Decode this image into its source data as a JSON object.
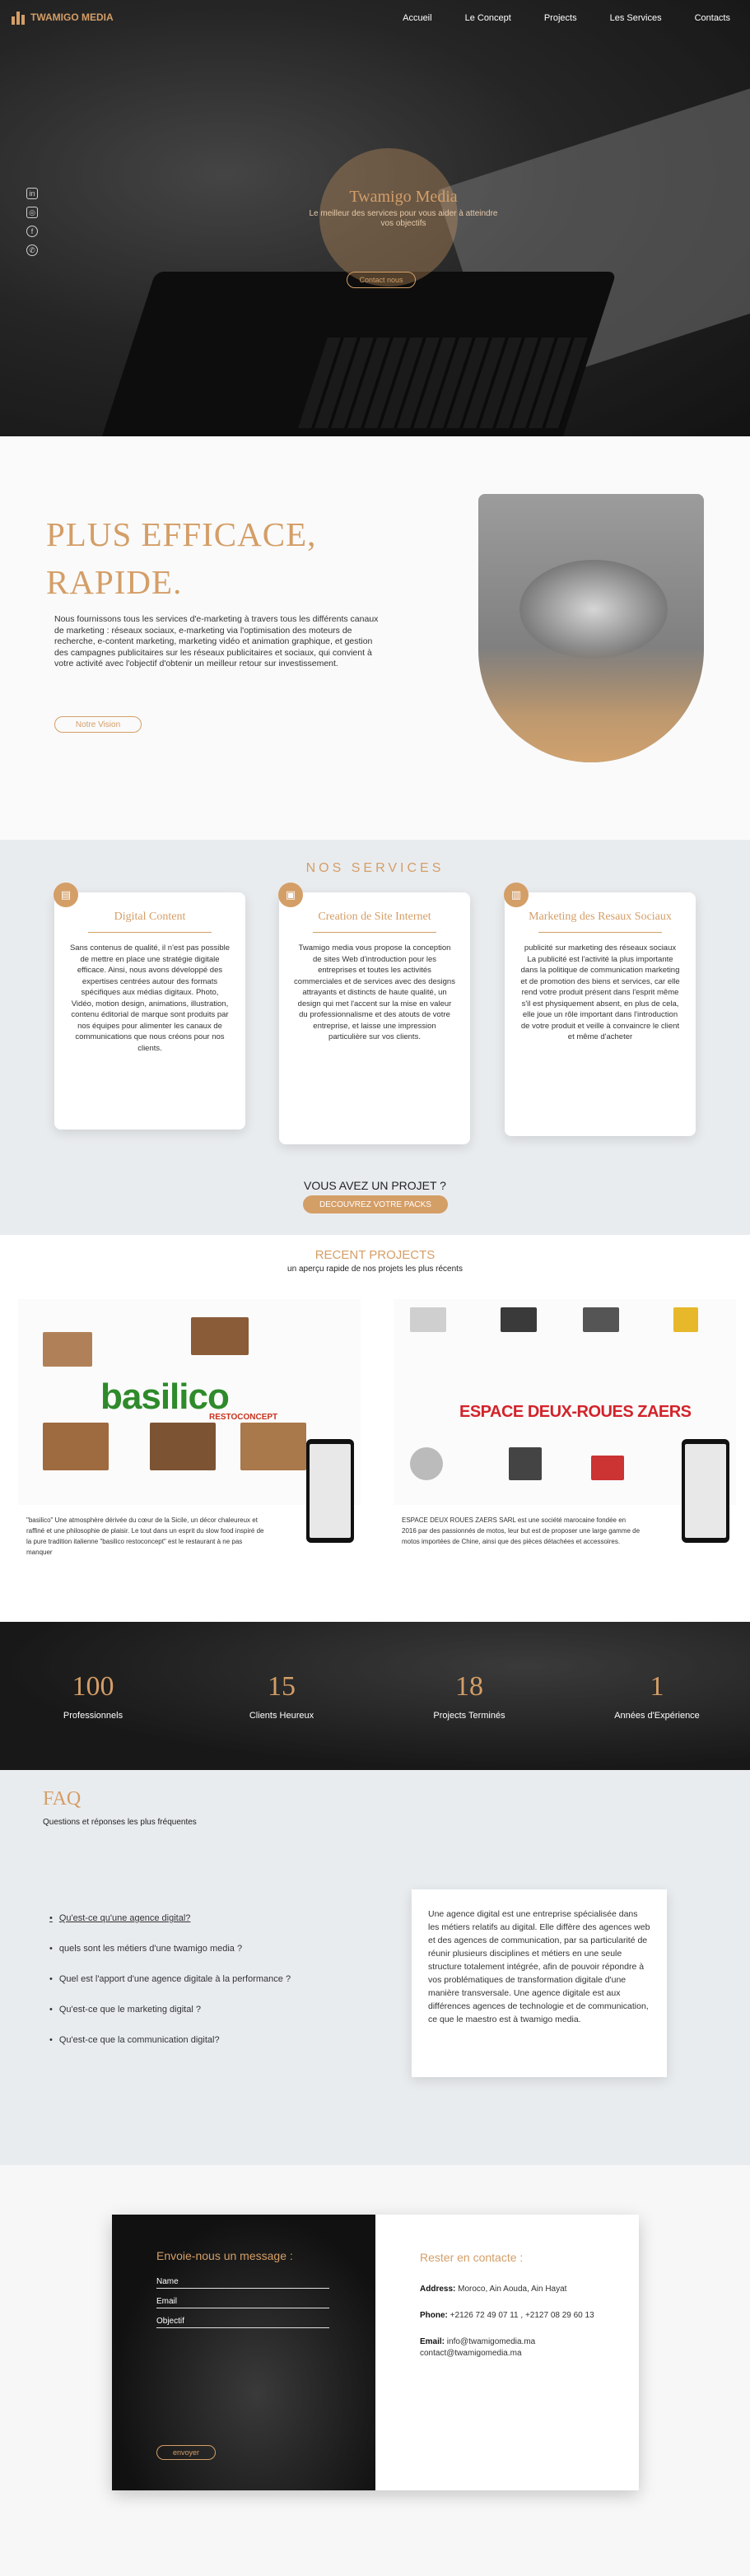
{
  "brand": {
    "name": "TWAMIGO MEDIA",
    "accent": "#d49e67"
  },
  "nav": [
    "Accueil",
    "Le Concept",
    "Projects",
    "Les Services",
    "Contacts"
  ],
  "social_icons": [
    "linkedin-icon",
    "instagram-icon",
    "facebook-icon",
    "whatsapp-icon"
  ],
  "hero": {
    "title": "Twamigo Media",
    "subtitle": "Le meilleur des services pour vous aider à atteindre vos objectifs",
    "button": "Contact nous"
  },
  "about": {
    "heading": "PLUS EFFICACE, RAPIDE.",
    "text": "Nous fournissons tous les services d'e-marketing à travers tous les différents canaux de marketing : réseaux sociaux, e-marketing via l'optimisation des moteurs de recherche, e-content marketing, marketing vidéo et animation graphique, et gestion des campagnes publicitaires sur les réseaux publicitaires et sociaux, qui convient à votre activité avec l'objectif d'obtenir un meilleur retour sur investissement.",
    "button": "Notre Vision"
  },
  "services": {
    "title": "NOS SERVICES",
    "cards": [
      {
        "title": "Digital Content",
        "icon": "content-icon",
        "text": "Sans contenus de qualité, il n'est pas possible de mettre en place une stratégie digitale efficace. Ainsi, nous avons développé des expertises centrées autour des formats spécifiques aux médias digitaux. Photo, Vidéo, motion design, animations, illustration, contenu éditorial de marque sont produits par nos équipes pour alimenter les canaux de communications que nous créons pour nos clients."
      },
      {
        "title": "Creation de Site Internet",
        "icon": "website-icon",
        "text": "Twamigo media vous propose la conception de sites Web d'introduction pour les entreprises et toutes les activités commerciales et de services avec des designs attrayants et distincts de haute qualité, un design qui met l'accent sur la mise en valeur du professionnalisme et des atouts de votre entreprise, et laisse une impression particulière sur vos clients."
      },
      {
        "title": "Marketing des Resaux Sociaux",
        "icon": "chart-icon",
        "text": "publicité sur marketing des réseaux sociaux La publicité est l'activité la plus importante dans la politique de communication marketing et de promotion des biens et services, car elle rend votre produit présent dans l'esprit même s'il est physiquement absent, en plus de cela, elle joue un rôle important dans l'introduction de votre produit et veille à convaincre le client et même d'acheter"
      }
    ],
    "project_question": "VOUS AVEZ UN PROJET ?",
    "project_button": "DECOUVREZ VOTRE PACKS"
  },
  "recent": {
    "title": "RECENT PROJECTS",
    "subtitle": "un aperçu rapide de nos projets les plus récents",
    "projects": [
      {
        "logo": "basilico",
        "tagline": "RESTOCONCEPT",
        "desc": "\"basilico\" Une atmosphère dérivée du cœur de la Sicile, un décor chaleureux et raffiné et une philosophie de plaisir. Le tout dans un esprit du slow food inspiré de la pure tradition italienne \"basilico restoconcept\" est le restaurant à ne pas manquer"
      },
      {
        "logo": "ESPACE DEUX-ROUES ZAERS",
        "tagline": "",
        "desc": "ESPACE DEUX ROUES ZAERS SARL est une société marocaine fondée en 2016 par des passionnés de motos, leur but est de proposer une large gamme de motos importées de Chine, ainsi que des pièces détachées et accessoires."
      }
    ]
  },
  "stats": [
    {
      "value": "100",
      "label": "Professionnels"
    },
    {
      "value": "15",
      "label": "Clients Heureux"
    },
    {
      "value": "18",
      "label": "Projects Terminés"
    },
    {
      "value": "1",
      "label": "Années d'Expérience"
    }
  ],
  "faq": {
    "title": "FAQ",
    "subtitle": "Questions et réponses les plus fréquentes",
    "questions": [
      "Qu'est-ce qu'une agence digital?",
      "quels sont les métiers d'une twamigo media ?",
      "Quel est l'apport d'une agence digitale à la performance ?",
      "Qu'est-ce que le marketing digital ?",
      "Qu'est-ce que la communication digital?"
    ],
    "answer": "Une agence digital est une entreprise spécialisée dans les métiers relatifs au digital. Elle diffère des agences web et des agences de communication, par sa particularité de réunir plusieurs disciplines et métiers en une seule structure totalement intégrée, afin de pouvoir répondre à vos problématiques de transformation digitale d'une manière transversale. Une agence digitale est aux différences agences de technologie et de communication, ce que le maestro est à twamigo media."
  },
  "contact": {
    "form_title": "Envoie-nous un message :",
    "fields": [
      "Name",
      "Email",
      "Objectif"
    ],
    "send": "envoyer",
    "info_title": "Rester en contacte :",
    "address_label": "Address:",
    "address": "Moroco, Ain Aouda, Ain Hayat",
    "phone_label": "Phone:",
    "phone": "+2126 72 49 07 11 , +2127 08 29 60 13",
    "email_label": "Email:",
    "email1": "info@twamigomedia.ma",
    "email2": "contact@twamigomedia.ma"
  }
}
